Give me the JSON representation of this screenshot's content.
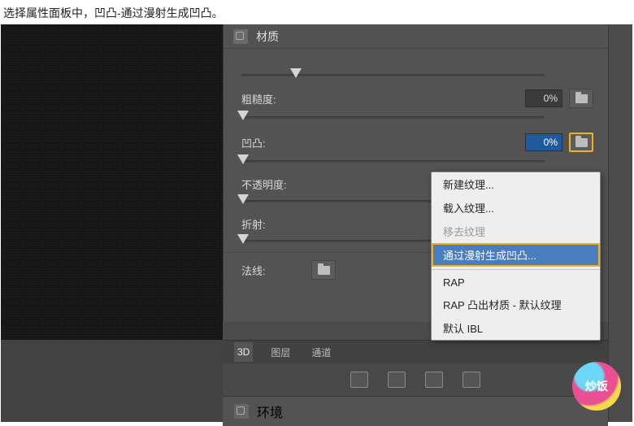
{
  "caption": "选择属性面板中，凹凸-通过漫射生成凹凸。",
  "panel": {
    "title": "材质"
  },
  "props": {
    "roughness": {
      "label": "粗糙度:",
      "value": "0%"
    },
    "bump": {
      "label": "凹凸:",
      "value": "0%"
    },
    "opacity": {
      "label": "不透明度:"
    },
    "refraction": {
      "label": "折射:"
    },
    "normal": {
      "label": "法线:"
    }
  },
  "menu": {
    "new_texture": "新建纹理...",
    "load_texture": "载入纹理...",
    "remove_texture": "移去纹理",
    "gen_bump": "通过漫射生成凹凸...",
    "rap": "RAP",
    "rap_extrude": "RAP 凸出材质 - 默认纹理",
    "default_ibl": "默认 IBL"
  },
  "tabs": {
    "t3d": "3D",
    "layers": "图层",
    "channels": "通道"
  },
  "env": {
    "title": "环境"
  },
  "badge": "炒饭"
}
